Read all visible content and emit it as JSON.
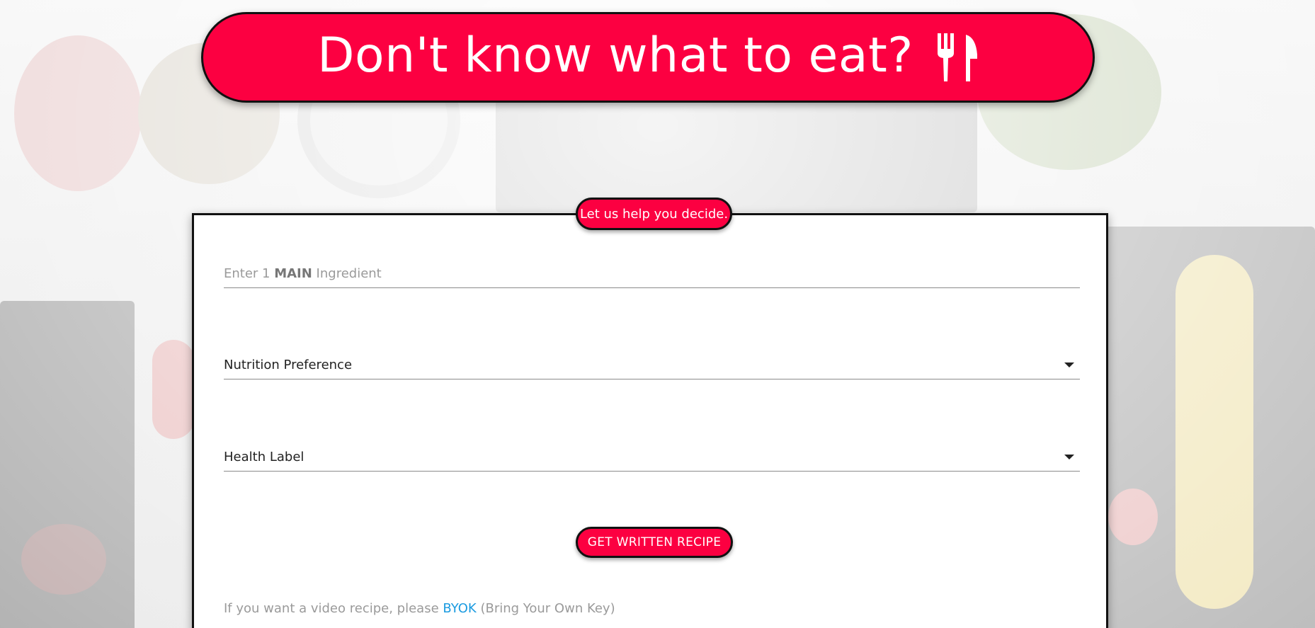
{
  "header": {
    "title": "Don't know what to eat?",
    "icon": "utensils-icon"
  },
  "card": {
    "tagline": "Let us help you decide.",
    "ingredient": {
      "placeholder_prefix": "Enter 1 ",
      "placeholder_emphasis": "MAIN",
      "placeholder_suffix": " Ingredient",
      "value": ""
    },
    "nutrition": {
      "label": "Nutrition Preference",
      "icon": "caret-down-icon"
    },
    "health": {
      "label": "Health Label",
      "icon": "caret-down-icon"
    },
    "submit_label": "GET WRITTEN RECIPE",
    "video_note": {
      "prefix": "If you want a video recipe, please ",
      "link": "BYOK",
      "suffix": " (Bring Your Own Key)"
    }
  },
  "colors": {
    "accent": "#fc0041",
    "link": "#1b9be0",
    "border": "#111111"
  }
}
